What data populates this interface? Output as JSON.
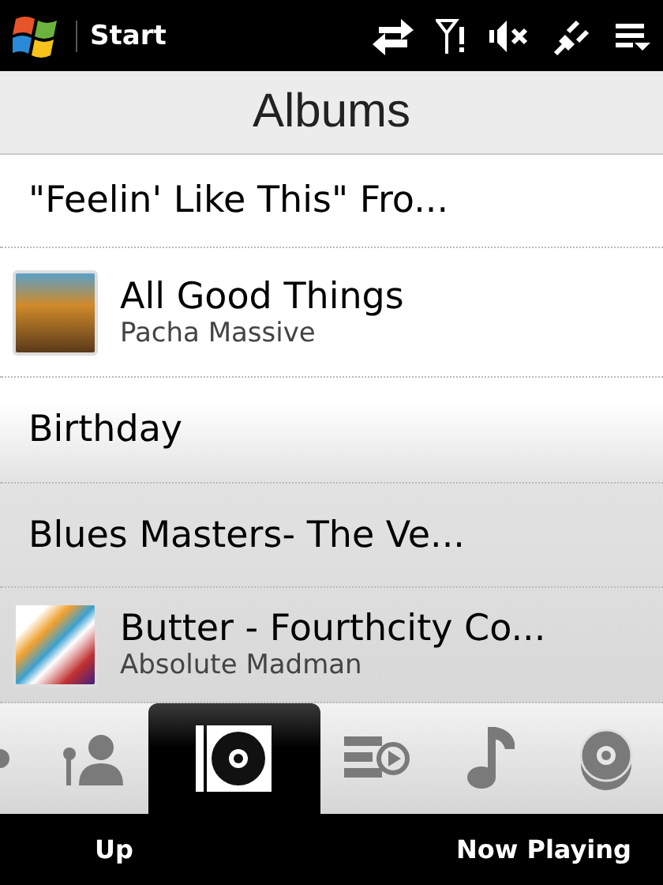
{
  "status_bar": {
    "title": "Start"
  },
  "header": {
    "title": "Albums"
  },
  "albums": [
    {
      "title": "\"Feelin' Like This\" Fro...",
      "kind": "plain"
    },
    {
      "title": "All Good Things",
      "artist": "Pacha Massive",
      "kind": "art"
    },
    {
      "title": "Birthday",
      "kind": "plain"
    },
    {
      "title": "Blues Masters- The Ve...",
      "kind": "plain"
    },
    {
      "title": "Butter - Fourthcity Co...",
      "artist": "Absolute Madman",
      "kind": "art"
    }
  ],
  "tabs": [
    {
      "kind": "partial",
      "selected": false
    },
    {
      "kind": "artists",
      "selected": false
    },
    {
      "kind": "albums",
      "selected": true
    },
    {
      "kind": "playlists",
      "selected": false
    },
    {
      "kind": "songs",
      "selected": false
    },
    {
      "kind": "discs",
      "selected": false
    }
  ],
  "soft_keys": {
    "left": "Up",
    "right": "Now Playing"
  }
}
